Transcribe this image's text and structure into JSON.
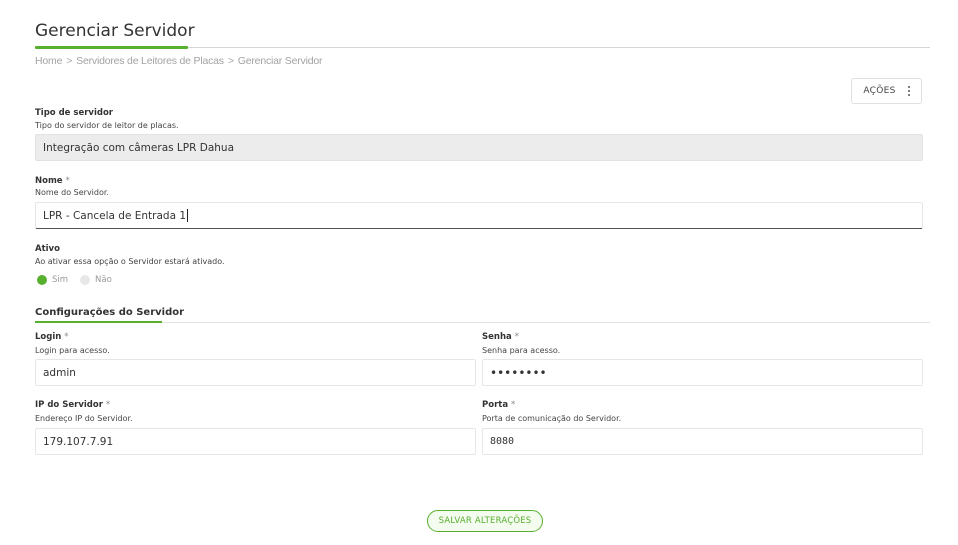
{
  "page": {
    "title": "Gerenciar Servidor",
    "breadcrumb": [
      "Home",
      ">",
      "Servidores de Leitores de Placas",
      ">",
      "Gerenciar Servidor"
    ]
  },
  "actions": {
    "label": "AÇÕES",
    "icon": "kebab-menu-icon"
  },
  "server_type": {
    "label": "Tipo de servidor",
    "help": "Tipo do servidor de leitor de placas.",
    "value": "Integração com câmeras LPR Dahua"
  },
  "name": {
    "label": "Nome",
    "required_mark": "*",
    "help": "Nome do Servidor.",
    "value": "LPR - Cancela de Entrada 1"
  },
  "active": {
    "label": "Ativo",
    "help": "Ao ativar essa opção o Servidor estará ativado.",
    "options": [
      "Sim",
      "Não"
    ],
    "selected": "Sim"
  },
  "config_section": {
    "title": "Configurações do Servidor"
  },
  "login": {
    "label": "Login",
    "required_mark": "*",
    "help": "Login para acesso.",
    "value": "admin"
  },
  "password": {
    "label": "Senha",
    "required_mark": "*",
    "help": "Senha para acesso.",
    "value": "••••••••"
  },
  "server_ip": {
    "label": "IP do Servidor",
    "required_mark": "*",
    "help": "Endereço IP do Servidor.",
    "value": "179.107.7.91"
  },
  "port": {
    "label": "Porta",
    "required_mark": "*",
    "help": "Porta de comunicação do Servidor.",
    "value": "8080"
  },
  "save": {
    "label": "SALVAR ALTERAÇÕES"
  },
  "colors": {
    "accent": "#58b030",
    "readonly_bg": "#ececec",
    "text": "#333333"
  }
}
